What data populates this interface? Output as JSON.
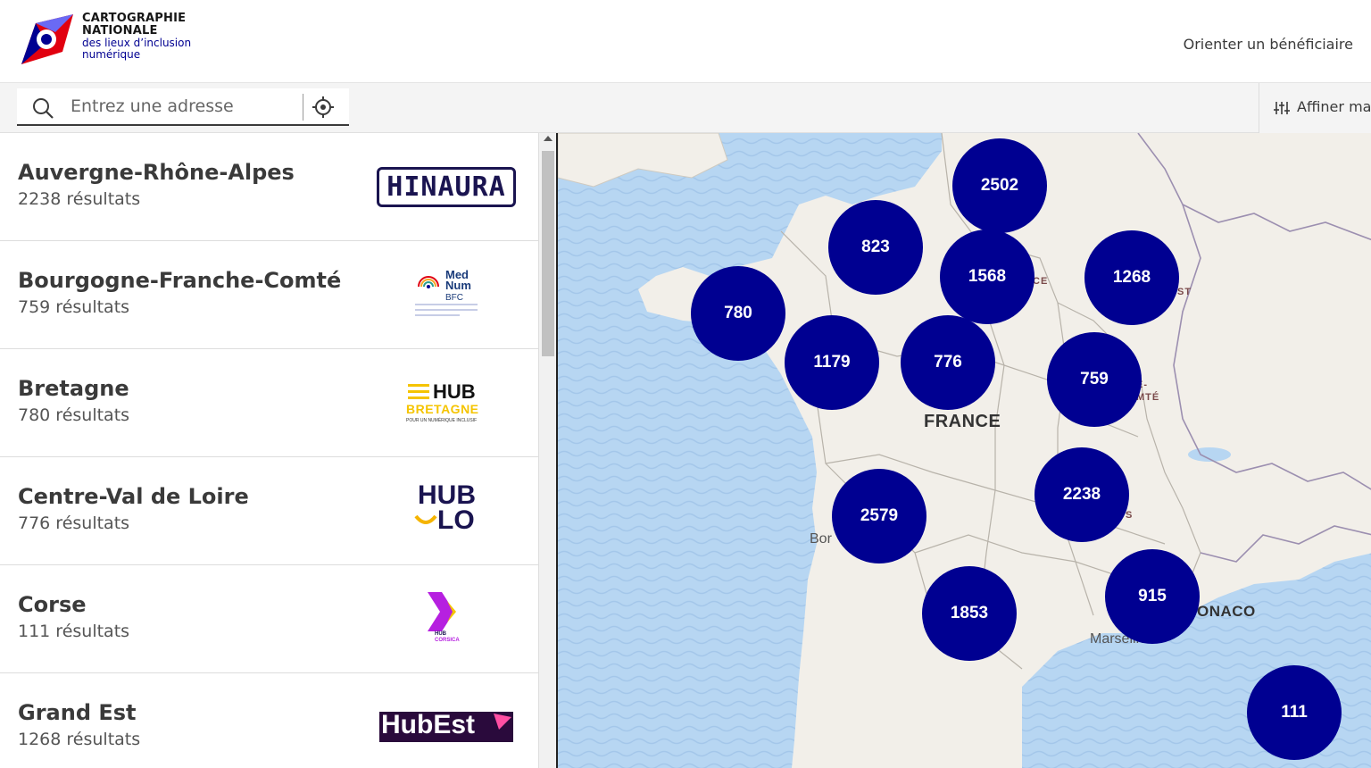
{
  "header": {
    "logo_line1": "CARTOGRAPHIE",
    "logo_line2": "NATIONALE",
    "logo_line3": "des lieux d’inclusion",
    "logo_line4": "numérique",
    "nav_link": "Orienter un bénéficiaire"
  },
  "search": {
    "placeholder": "Entrez une adresse",
    "refine_label": "Affiner ma"
  },
  "regions": [
    {
      "name": "Auvergne-Rhône-Alpes",
      "count": "2238 résultats",
      "logo": "HINAURA"
    },
    {
      "name": "Bourgogne-Franche-Comté",
      "count": "759 résultats",
      "logo_a": "Med",
      "logo_b": "Num",
      "logo_c": "BFC"
    },
    {
      "name": "Bretagne",
      "count": "780 résultats",
      "logo_a": "HUB",
      "logo_b": "BRETAGNE",
      "logo_c": "POUR UN NUMÉRIQUE INCLUSIF"
    },
    {
      "name": "Centre-Val de Loire",
      "count": "776 résultats",
      "logo_a": "HUB",
      "logo_b": "LO"
    },
    {
      "name": "Corse",
      "count": "111 résultats",
      "logo_a": "HUB",
      "logo_b": "CORSICA"
    },
    {
      "name": "Grand Est",
      "count": "1268 résultats",
      "logo": "HubEst"
    }
  ],
  "map": {
    "country_label": "FRANCE",
    "city_bordeaux": "Bor",
    "city_marseille": "Marseille",
    "monaco": "ONACO",
    "region_ce": "CE",
    "region_st": "ST",
    "region_mte": "MTÉ",
    "region_e": "E-",
    "region_s": "S",
    "clusters": [
      "2502",
      "823",
      "1568",
      "1268",
      "780",
      "1179",
      "776",
      "759",
      "2579",
      "2238",
      "1853",
      "915",
      "111"
    ]
  },
  "colors": {
    "primary": "#000091",
    "sea": "#aed0f0",
    "land": "#f2efe9"
  }
}
